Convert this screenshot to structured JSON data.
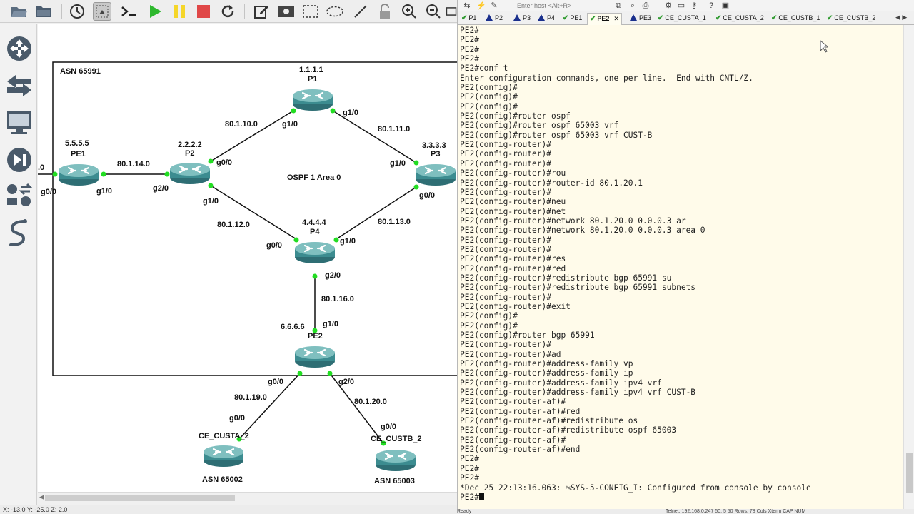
{
  "gns3": {
    "toolbar_icons": [
      "folder-open-icon",
      "folder-icon",
      "clock-icon",
      "screenshot-icon",
      "terminal-icon",
      "play-icon",
      "pause-icon",
      "stop-icon",
      "reload-icon",
      "note-icon",
      "image-icon",
      "rectangle-icon",
      "ellipse-icon",
      "line-icon",
      "lock-icon",
      "zoom-in-icon",
      "zoom-out-icon",
      "snapshot-icon"
    ],
    "dock_icons": [
      "routers-icon",
      "switches-icon",
      "end-devices-icon",
      "security-devices-icon",
      "all-devices-icon",
      "add-link-icon"
    ],
    "status_text": "X: -13.0 Y: -25.0 Z: 2.0",
    "topology": {
      "asn_box_label": "ASN 65991",
      "area_label": "OSPF 1 Area 0",
      "partial_label": ".0",
      "nodes": [
        {
          "id": "P1",
          "loopback": "1.1.1.1",
          "name": "P1"
        },
        {
          "id": "P2",
          "loopback": "2.2.2.2",
          "name": "P2"
        },
        {
          "id": "P3",
          "loopback": "3.3.3.3",
          "name": "P3"
        },
        {
          "id": "P4",
          "loopback": "4.4.4.4",
          "name": "P4"
        },
        {
          "id": "PE1",
          "loopback": "5.5.5.5",
          "name": "PE1"
        },
        {
          "id": "PE2",
          "loopback": "6.6.6.6",
          "name": "PE2"
        },
        {
          "id": "CEA2",
          "name": "CE_CUSTA_2",
          "asn": "ASN 65002"
        },
        {
          "id": "CEB2",
          "name": "CE_CUSTB_2",
          "asn": "ASN 65003"
        }
      ],
      "links": [
        {
          "subnet": "80.1.10.0",
          "a_if": "g0/0",
          "b_if": "g1/0"
        },
        {
          "subnet": "80.1.11.0",
          "a_if": "g1/0",
          "b_if": "g1/0"
        },
        {
          "subnet": "80.1.14.0",
          "a_if": "g1/0",
          "b_if": "g2/0"
        },
        {
          "subnet": "80.1.12.0",
          "a_if": "g1/0",
          "b_if": "g0/0"
        },
        {
          "subnet": "80.1.13.0",
          "a_if": "g0/0",
          "b_if": "g1/0"
        },
        {
          "subnet": "80.1.16.0",
          "a_if": "g2/0",
          "b_if": "g1/0"
        },
        {
          "subnet": "80.1.19.0",
          "a_if": "g0/0",
          "b_if": "g0/0"
        },
        {
          "subnet": "80.1.20.0",
          "a_if": "g2/0",
          "b_if": "g0/0"
        }
      ],
      "pe1_left_if": "g0/0"
    }
  },
  "console": {
    "host_placeholder": "Enter host <Alt+R>",
    "tabs": [
      {
        "label": "P1",
        "status": "ok"
      },
      {
        "label": "P2",
        "status": "warn"
      },
      {
        "label": "P3",
        "status": "warn"
      },
      {
        "label": "P4",
        "status": "warn"
      },
      {
        "label": "PE1",
        "status": "ok"
      },
      {
        "label": "PE2",
        "status": "ok",
        "active": true
      },
      {
        "label": "PE3",
        "status": "warn"
      },
      {
        "label": "CE_CUSTA_1",
        "status": "ok"
      },
      {
        "label": "CE_CUSTA_2",
        "status": "ok"
      },
      {
        "label": "CE_CUSTB_1",
        "status": "ok"
      },
      {
        "label": "CE_CUSTB_2",
        "status": "ok"
      }
    ],
    "terminal_lines": [
      "PE2#",
      "PE2#",
      "PE2#",
      "PE2#",
      "PE2#conf t",
      "Enter configuration commands, one per line.  End with CNTL/Z.",
      "PE2(config)#",
      "PE2(config)#",
      "PE2(config)#",
      "PE2(config)#router ospf",
      "PE2(config)#router ospf 65003 vrf",
      "PE2(config)#router ospf 65003 vrf CUST-B",
      "PE2(config-router)#",
      "PE2(config-router)#",
      "PE2(config-router)#",
      "PE2(config-router)#rou",
      "PE2(config-router)#router-id 80.1.20.1",
      "PE2(config-router)#",
      "PE2(config-router)#neu",
      "PE2(config-router)#net",
      "PE2(config-router)#network 80.1.20.0 0.0.0.3 ar",
      "PE2(config-router)#network 80.1.20.0 0.0.0.3 area 0",
      "PE2(config-router)#",
      "PE2(config-router)#",
      "PE2(config-router)#res",
      "PE2(config-router)#red",
      "PE2(config-router)#redistribute bgp 65991 su",
      "PE2(config-router)#redistribute bgp 65991 subnets",
      "PE2(config-router)#",
      "PE2(config-router)#exit",
      "PE2(config)#",
      "PE2(config)#",
      "PE2(config)#router bgp 65991",
      "PE2(config-router)#",
      "PE2(config-router)#ad",
      "PE2(config-router)#address-family vp",
      "PE2(config-router)#address-family ip",
      "PE2(config-router)#address-family ipv4 vrf",
      "PE2(config-router)#address-family ipv4 vrf CUST-B",
      "PE2(config-router-af)#",
      "PE2(config-router-af)#red",
      "PE2(config-router-af)#redistribute os",
      "PE2(config-router-af)#redistribute ospf 65003",
      "PE2(config-router-af)#",
      "PE2(config-router-af)#end",
      "PE2#",
      "PE2#",
      "PE2#",
      "*Dec 25 22:13:16.063: %SYS-5-CONFIG_I: Configured from console by console"
    ],
    "prompt": "PE2#",
    "status_left": "Ready",
    "status_right": "Telnet: 192.168.0.247     50,  5   50 Rows, 78 Cols     Xterm     CAP NUM"
  }
}
